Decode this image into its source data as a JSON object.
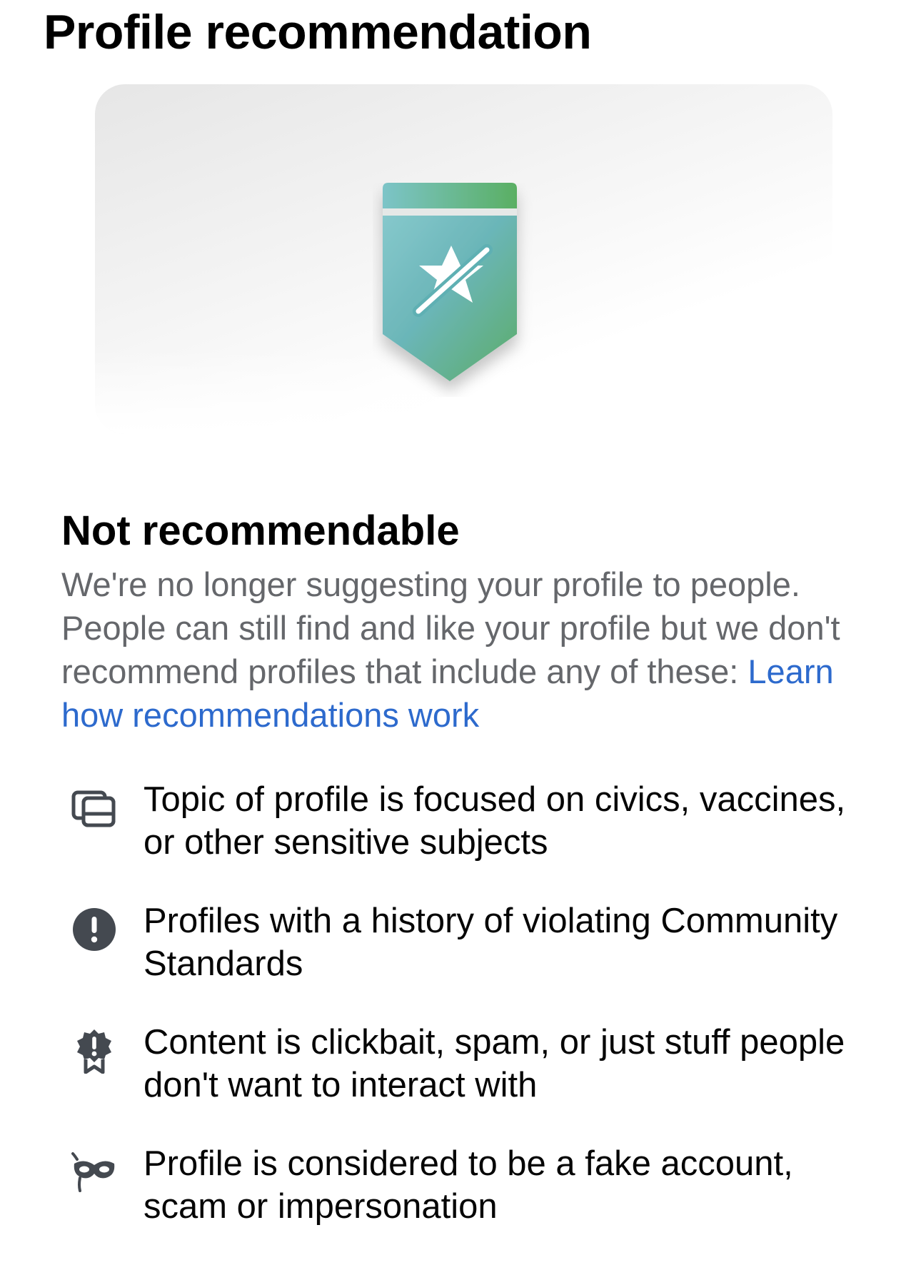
{
  "header": {
    "title": "Profile recommendation"
  },
  "hero": {
    "badge_icon": "recommendation-off-badge-icon",
    "badge_colors": {
      "teal": "#62b3b9",
      "green": "#4fa65c"
    }
  },
  "status": {
    "title": "Not recommendable",
    "description": "We're no longer suggesting your profile to people. People can still find and like your profile but we don't recommend profiles that include any of these: ",
    "link_label": "Learn how recommendations work",
    "link_color": "#2d6acd"
  },
  "reasons": [
    {
      "icon": "sensitive-topics-icon",
      "text": "Topic of profile is focused on civics, vaccines, or other sensitive subjects"
    },
    {
      "icon": "alert-circle-icon",
      "text": "Profiles with a history of violating Community Standards"
    },
    {
      "icon": "warning-badge-icon",
      "text": "Content is clickbait, spam, or just stuff people don't want to interact with"
    },
    {
      "icon": "mask-icon",
      "text": "Profile is considered to be a fake account, scam or impersonation"
    }
  ]
}
